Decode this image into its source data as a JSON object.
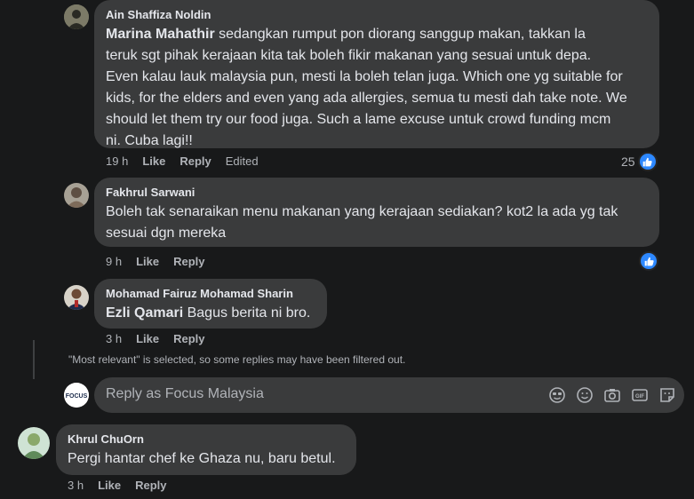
{
  "comments": [
    {
      "author": "Ain Shaffiza Noldin",
      "mention": "Marina Mahathir",
      "lines": [
        " sedangkan rumput pon diorang sanggup makan, takkan la",
        "teruk sgt pihak kerajaan kita tak boleh fikir makanan yang sesuai untuk depa.",
        "Even kalau lauk malaysia pun, mesti la boleh telan juga. Which one yg suitable for",
        "kids, for the elders and even yang ada allergies, semua tu mesti dah take note. We",
        "should let them try our food juga. Such a lame excuse untuk crowd funding mcm",
        "ni. Cuba lagi!!"
      ],
      "time": "19 h",
      "like": "Like",
      "reply": "Reply",
      "edited": "Edited",
      "reaction_count": "25"
    },
    {
      "author": "Fakhrul Sarwani",
      "lines": [
        "Boleh tak senaraikan menu makanan yang kerajaan sediakan? kot2 la ada yg tak",
        "sesuai dgn mereka"
      ],
      "time": "9 h",
      "like": "Like",
      "reply": "Reply"
    },
    {
      "author": "Mohamad Fairuz Mohamad Sharin",
      "mention": "Ezli Qamari",
      "text": " Bagus berita ni bro.",
      "time": "3 h",
      "like": "Like",
      "reply": "Reply"
    },
    {
      "author": "Khrul ChuOrn",
      "text": "Pergi hantar chef ke Ghaza nu, baru betul.",
      "time": "3 h",
      "like": "Like",
      "reply": "Reply"
    }
  ],
  "filter_note": "\"Most relevant\" is selected, so some replies may have been filtered out.",
  "reply_box": {
    "placeholder": "Reply as Focus Malaysia",
    "page_avatar_text": "FOCUS"
  },
  "colors": {
    "background": "#18191a",
    "bubble": "#3a3b3c",
    "like_blue": "#2d88ff"
  }
}
